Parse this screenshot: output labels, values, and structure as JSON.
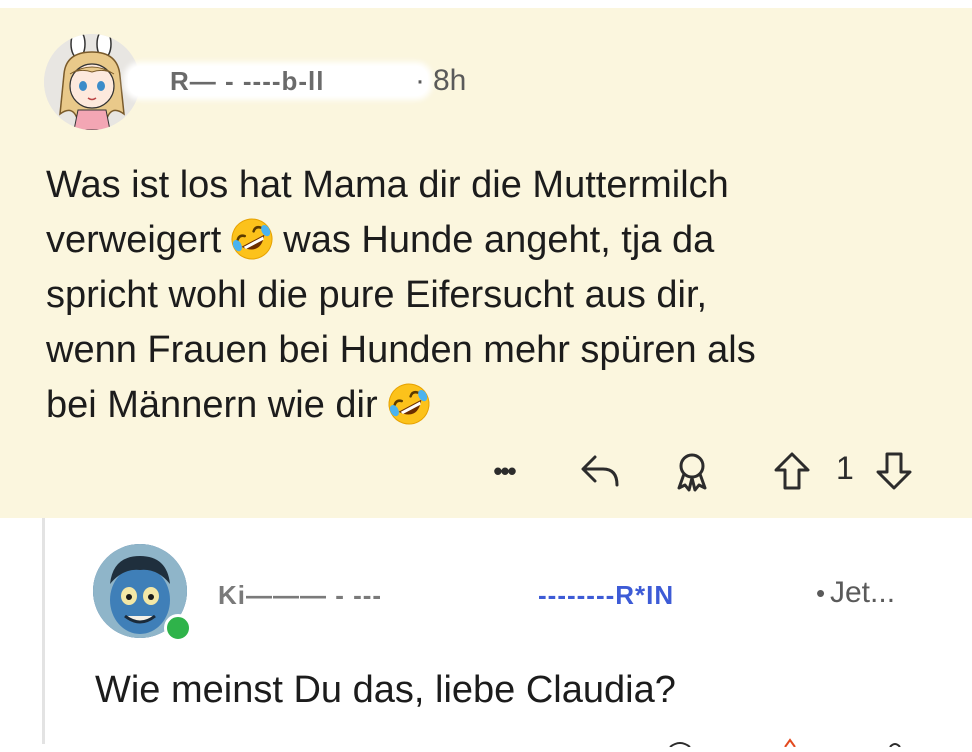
{
  "comment1": {
    "username_obscured": "R— ‐ ‐‐‐‐b‐ll",
    "time": "8h",
    "separator": "·",
    "body_line1": "Was ist los hat Mama dir die Muttermilch",
    "body_line2a": "verweigert",
    "body_line2b": "was Hunde angeht, tja da",
    "body_line3": "spricht wohl die pure Eifersucht aus dir,",
    "body_line4": "wenn Frauen bei Hunden mehr spüren als",
    "body_line5": "bei Männern wie dir",
    "emoji": "rolling-on-floor-laughing",
    "actions": {
      "more_label": "•••",
      "vote_count": "1"
    },
    "highlight_color": "#fbf6de"
  },
  "comment2": {
    "username_obscured_a": "Ki——— ‐ ‐‐‐",
    "username_obscured_b": "‐‐‐‐‐‐‐‐R*IN",
    "separator": "•",
    "time": "Jet...",
    "body": "Wie meinst Du das, liebe Claudia?",
    "online_color": "#2fb34a"
  }
}
